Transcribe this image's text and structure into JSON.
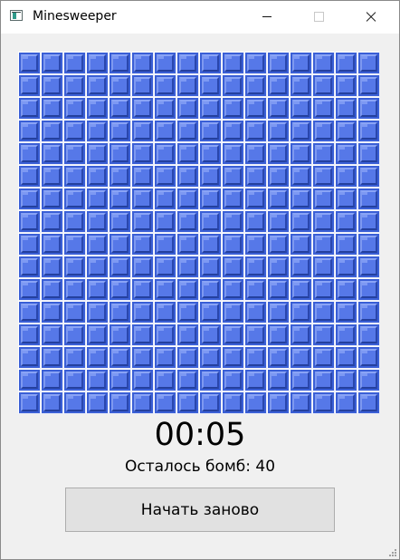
{
  "window": {
    "title": "Minesweeper",
    "icon": "minesweeper-app-icon",
    "controls": [
      "minimize-icon",
      "maximize-icon",
      "close-icon"
    ]
  },
  "board": {
    "rows": 16,
    "columns": 16,
    "state": "all-covered",
    "cell_color": "#4a6de0"
  },
  "status": {
    "timer": "00:05",
    "bombs_left": "Осталось бомб: 40"
  },
  "actions": {
    "restart_label": "Начать заново"
  }
}
